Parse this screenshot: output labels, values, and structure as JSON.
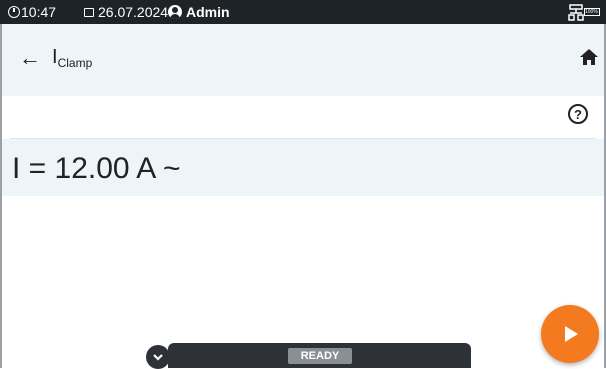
{
  "status_bar": {
    "time": "10:47",
    "date": "26.07.2024",
    "user": "Admin",
    "battery": "100%",
    "clock_icon": "clock-icon",
    "calendar_icon": "calendar-icon",
    "user_icon": "account-circle-icon",
    "network_icon": "network-icon"
  },
  "header": {
    "title_main": "I",
    "title_sub": "Clamp",
    "back_icon": "arrow-left-icon",
    "home_icon": "home-icon"
  },
  "help": {
    "label": "?"
  },
  "result": {
    "text": "I = 12.00 A ~"
  },
  "bottom_bar": {
    "status": "READY",
    "expand_icon": "chevron-down-icon"
  },
  "play_button": {
    "icon": "play-icon"
  },
  "colors": {
    "status_bg": "#1e2328",
    "header_bg": "#eef5f9",
    "accent": "#f47a20",
    "bar_bg": "#2e3238",
    "ready_bg": "#8a8f96"
  }
}
